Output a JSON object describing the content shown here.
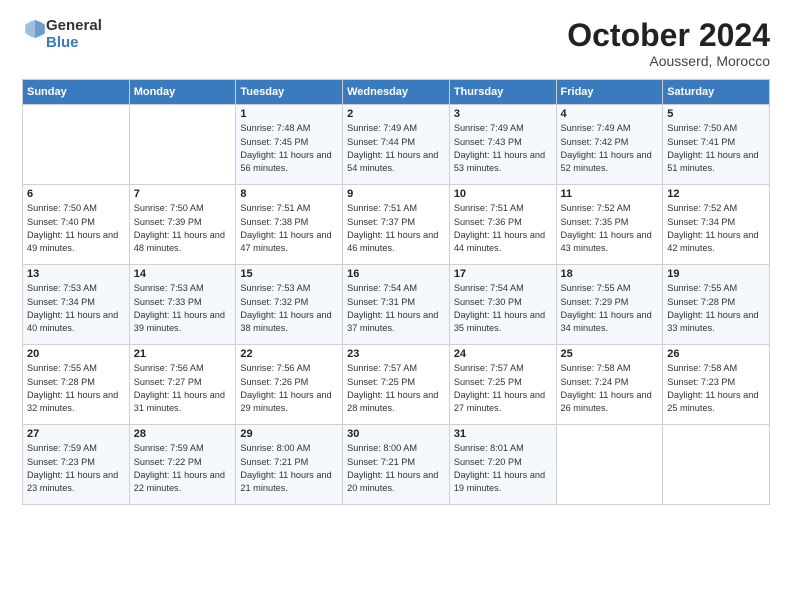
{
  "header": {
    "logo_general": "General",
    "logo_blue": "Blue",
    "month_title": "October 2024",
    "subtitle": "Aousserd, Morocco"
  },
  "days_of_week": [
    "Sunday",
    "Monday",
    "Tuesday",
    "Wednesday",
    "Thursday",
    "Friday",
    "Saturday"
  ],
  "weeks": [
    [
      {
        "day": "",
        "detail": ""
      },
      {
        "day": "",
        "detail": ""
      },
      {
        "day": "1",
        "detail": "Sunrise: 7:48 AM\nSunset: 7:45 PM\nDaylight: 11 hours and 56 minutes."
      },
      {
        "day": "2",
        "detail": "Sunrise: 7:49 AM\nSunset: 7:44 PM\nDaylight: 11 hours and 54 minutes."
      },
      {
        "day": "3",
        "detail": "Sunrise: 7:49 AM\nSunset: 7:43 PM\nDaylight: 11 hours and 53 minutes."
      },
      {
        "day": "4",
        "detail": "Sunrise: 7:49 AM\nSunset: 7:42 PM\nDaylight: 11 hours and 52 minutes."
      },
      {
        "day": "5",
        "detail": "Sunrise: 7:50 AM\nSunset: 7:41 PM\nDaylight: 11 hours and 51 minutes."
      }
    ],
    [
      {
        "day": "6",
        "detail": "Sunrise: 7:50 AM\nSunset: 7:40 PM\nDaylight: 11 hours and 49 minutes."
      },
      {
        "day": "7",
        "detail": "Sunrise: 7:50 AM\nSunset: 7:39 PM\nDaylight: 11 hours and 48 minutes."
      },
      {
        "day": "8",
        "detail": "Sunrise: 7:51 AM\nSunset: 7:38 PM\nDaylight: 11 hours and 47 minutes."
      },
      {
        "day": "9",
        "detail": "Sunrise: 7:51 AM\nSunset: 7:37 PM\nDaylight: 11 hours and 46 minutes."
      },
      {
        "day": "10",
        "detail": "Sunrise: 7:51 AM\nSunset: 7:36 PM\nDaylight: 11 hours and 44 minutes."
      },
      {
        "day": "11",
        "detail": "Sunrise: 7:52 AM\nSunset: 7:35 PM\nDaylight: 11 hours and 43 minutes."
      },
      {
        "day": "12",
        "detail": "Sunrise: 7:52 AM\nSunset: 7:34 PM\nDaylight: 11 hours and 42 minutes."
      }
    ],
    [
      {
        "day": "13",
        "detail": "Sunrise: 7:53 AM\nSunset: 7:34 PM\nDaylight: 11 hours and 40 minutes."
      },
      {
        "day": "14",
        "detail": "Sunrise: 7:53 AM\nSunset: 7:33 PM\nDaylight: 11 hours and 39 minutes."
      },
      {
        "day": "15",
        "detail": "Sunrise: 7:53 AM\nSunset: 7:32 PM\nDaylight: 11 hours and 38 minutes."
      },
      {
        "day": "16",
        "detail": "Sunrise: 7:54 AM\nSunset: 7:31 PM\nDaylight: 11 hours and 37 minutes."
      },
      {
        "day": "17",
        "detail": "Sunrise: 7:54 AM\nSunset: 7:30 PM\nDaylight: 11 hours and 35 minutes."
      },
      {
        "day": "18",
        "detail": "Sunrise: 7:55 AM\nSunset: 7:29 PM\nDaylight: 11 hours and 34 minutes."
      },
      {
        "day": "19",
        "detail": "Sunrise: 7:55 AM\nSunset: 7:28 PM\nDaylight: 11 hours and 33 minutes."
      }
    ],
    [
      {
        "day": "20",
        "detail": "Sunrise: 7:55 AM\nSunset: 7:28 PM\nDaylight: 11 hours and 32 minutes."
      },
      {
        "day": "21",
        "detail": "Sunrise: 7:56 AM\nSunset: 7:27 PM\nDaylight: 11 hours and 31 minutes."
      },
      {
        "day": "22",
        "detail": "Sunrise: 7:56 AM\nSunset: 7:26 PM\nDaylight: 11 hours and 29 minutes."
      },
      {
        "day": "23",
        "detail": "Sunrise: 7:57 AM\nSunset: 7:25 PM\nDaylight: 11 hours and 28 minutes."
      },
      {
        "day": "24",
        "detail": "Sunrise: 7:57 AM\nSunset: 7:25 PM\nDaylight: 11 hours and 27 minutes."
      },
      {
        "day": "25",
        "detail": "Sunrise: 7:58 AM\nSunset: 7:24 PM\nDaylight: 11 hours and 26 minutes."
      },
      {
        "day": "26",
        "detail": "Sunrise: 7:58 AM\nSunset: 7:23 PM\nDaylight: 11 hours and 25 minutes."
      }
    ],
    [
      {
        "day": "27",
        "detail": "Sunrise: 7:59 AM\nSunset: 7:23 PM\nDaylight: 11 hours and 23 minutes."
      },
      {
        "day": "28",
        "detail": "Sunrise: 7:59 AM\nSunset: 7:22 PM\nDaylight: 11 hours and 22 minutes."
      },
      {
        "day": "29",
        "detail": "Sunrise: 8:00 AM\nSunset: 7:21 PM\nDaylight: 11 hours and 21 minutes."
      },
      {
        "day": "30",
        "detail": "Sunrise: 8:00 AM\nSunset: 7:21 PM\nDaylight: 11 hours and 20 minutes."
      },
      {
        "day": "31",
        "detail": "Sunrise: 8:01 AM\nSunset: 7:20 PM\nDaylight: 11 hours and 19 minutes."
      },
      {
        "day": "",
        "detail": ""
      },
      {
        "day": "",
        "detail": ""
      }
    ]
  ]
}
